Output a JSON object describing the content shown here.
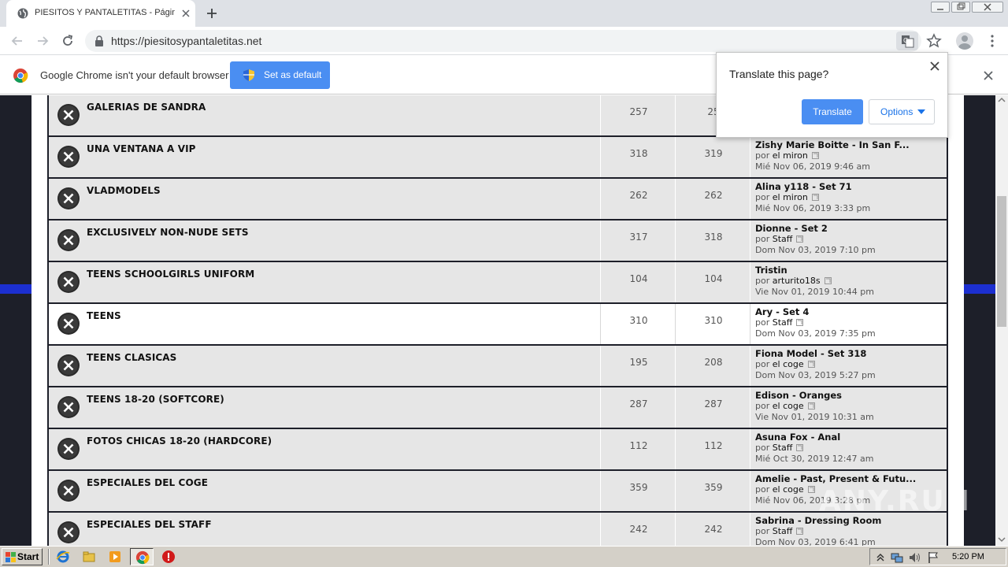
{
  "browser": {
    "tab_title": "PIESITOS Y PANTALETITAS - Página",
    "url": "https://piesitosypantaletitas.net"
  },
  "infobar": {
    "message": "Google Chrome isn't your default browser",
    "button_label": "Set as default"
  },
  "translate_popup": {
    "title": "Translate this page?",
    "translate_label": "Translate",
    "options_label": "Options"
  },
  "forums": [
    {
      "title": "GALERIAS DE SANDRA",
      "topics": "257",
      "posts": "25",
      "last_title": "",
      "last_by_prefix": "",
      "last_author": "",
      "last_date": ""
    },
    {
      "title": "UNA VENTANA A VIP",
      "topics": "318",
      "posts": "319",
      "last_title": "Zishy Marie Boitte - In San F...",
      "last_by_prefix": "por",
      "last_author": "el miron",
      "last_date": "Mié Nov 06, 2019 9:46 am"
    },
    {
      "title": "VLADMODELS",
      "topics": "262",
      "posts": "262",
      "last_title": "Alina y118 - Set 71",
      "last_by_prefix": "por",
      "last_author": "el miron",
      "last_date": "Mié Nov 06, 2019 3:33 pm"
    },
    {
      "title": "EXCLUSIVELY NON-NUDE SETS",
      "topics": "317",
      "posts": "318",
      "last_title": "Dionne - Set 2",
      "last_by_prefix": "por",
      "last_author": "Staff",
      "last_date": "Dom Nov 03, 2019 7:10 pm"
    },
    {
      "title": "TEENS SCHOOLGIRLS UNIFORM",
      "topics": "104",
      "posts": "104",
      "last_title": "Tristin",
      "last_by_prefix": "por",
      "last_author": "arturito18s",
      "last_date": "Vie Nov 01, 2019 10:44 pm"
    },
    {
      "title": "TEENS",
      "topics": "310",
      "posts": "310",
      "last_title": "Ary - Set 4",
      "last_by_prefix": "por",
      "last_author": "Staff",
      "last_date": "Dom Nov 03, 2019 7:35 pm"
    },
    {
      "title": "TEENS CLASICAS",
      "topics": "195",
      "posts": "208",
      "last_title": "Fiona Model - Set 318",
      "last_by_prefix": "por",
      "last_author": "el coge",
      "last_date": "Dom Nov 03, 2019 5:27 pm"
    },
    {
      "title": "TEENS 18-20 (SOFTCORE)",
      "topics": "287",
      "posts": "287",
      "last_title": "Edison - Oranges",
      "last_by_prefix": "por",
      "last_author": "el coge",
      "last_date": "Vie Nov 01, 2019 10:31 am"
    },
    {
      "title": "FOTOS CHICAS 18-20 (HARDCORE)",
      "topics": "112",
      "posts": "112",
      "last_title": "Asuna Fox - Anal",
      "last_by_prefix": "por",
      "last_author": "Staff",
      "last_date": "Mié Oct 30, 2019 12:47 am"
    },
    {
      "title": "ESPECIALES DEL COGE",
      "topics": "359",
      "posts": "359",
      "last_title": "Amelie - Past, Present & Futu...",
      "last_by_prefix": "por",
      "last_author": "el coge",
      "last_date": "Mié Nov 06, 2019 3:28 pm"
    },
    {
      "title": "ESPECIALES DEL STAFF",
      "topics": "242",
      "posts": "242",
      "last_title": "Sabrina - Dressing Room",
      "last_by_prefix": "por",
      "last_author": "Staff",
      "last_date": "Dom Nov 03, 2019 6:41 pm"
    }
  ],
  "watermark": "ANY.RUN",
  "taskbar": {
    "start_label": "Start",
    "clock": "5:20 PM"
  },
  "colors": {
    "accent_blue": "#4a8ef2",
    "page_dark": "#1d1f29",
    "row_bg": "#e6e6e6",
    "stripe_blue": "#1c2fd0"
  }
}
